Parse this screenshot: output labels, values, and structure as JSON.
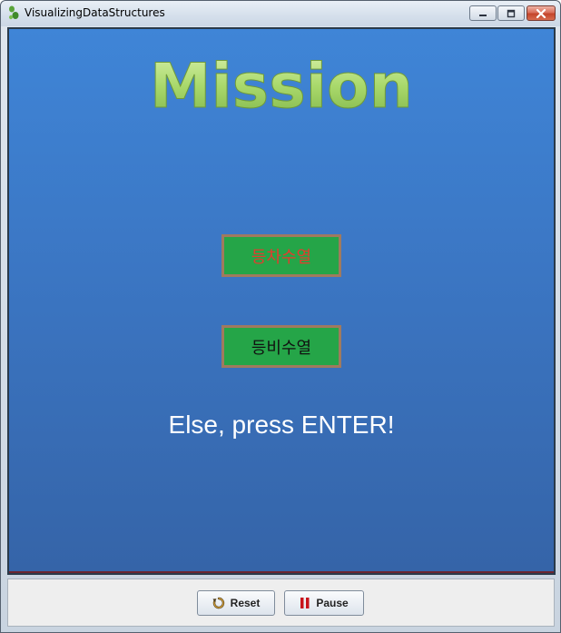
{
  "window": {
    "title": "VisualizingDataStructures",
    "icon": "footprint-app-icon",
    "controls": [
      "minimize",
      "maximize",
      "close"
    ]
  },
  "canvas": {
    "title": "Mission",
    "options": [
      {
        "label": "등차수열",
        "color": "#e43b2e"
      },
      {
        "label": "등비수열",
        "color": "#111111"
      }
    ],
    "hint": "Else, press ENTER!",
    "colors": {
      "background_top": "#3f85d7",
      "background_bottom": "#3564a8",
      "title_green": "#a8d86a",
      "button_fill": "#25a548",
      "button_border": "#a07a5e"
    }
  },
  "controls": {
    "reset_label": "Reset",
    "pause_label": "Pause",
    "reset_icon": "reset-icon",
    "pause_icon": "pause-icon"
  }
}
